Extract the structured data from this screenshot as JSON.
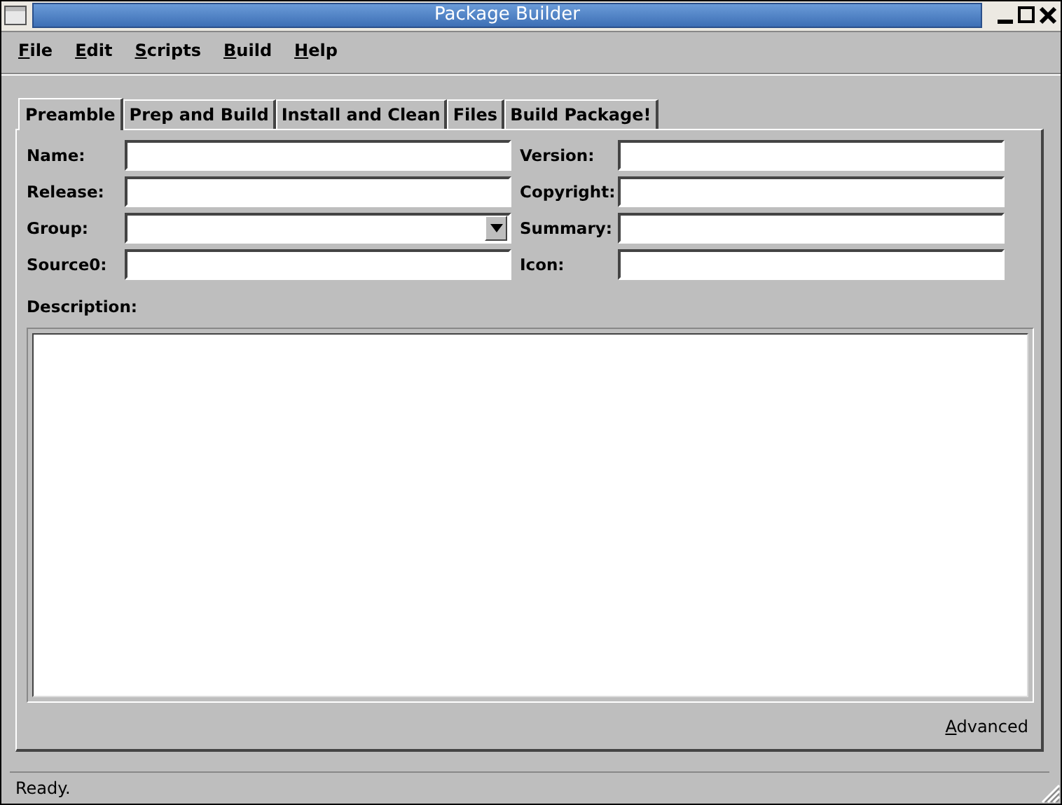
{
  "window": {
    "title": "Package Builder"
  },
  "menu": [
    "File",
    "Edit",
    "Scripts",
    "Build",
    "Help"
  ],
  "tabs": [
    {
      "label": "Preamble",
      "selected": true
    },
    {
      "label": "Prep and Build",
      "selected": false
    },
    {
      "label": "Install and Clean",
      "selected": false
    },
    {
      "label": "Files",
      "selected": false
    },
    {
      "label": "Build Package!",
      "selected": false
    }
  ],
  "fields": [
    {
      "label": "Name:",
      "kind": "text"
    },
    {
      "label": "Version:",
      "kind": "text"
    },
    {
      "label": "Release:",
      "kind": "text"
    },
    {
      "label": "Copyright:",
      "kind": "text"
    },
    {
      "label": "Group:",
      "kind": "combo"
    },
    {
      "label": "Summary:",
      "kind": "text"
    },
    {
      "label": "Source0:",
      "kind": "text"
    },
    {
      "label": "Icon:",
      "kind": "text"
    }
  ],
  "description": {
    "label": "Description:"
  },
  "advanced_button": "Advanced",
  "status_bar": "Ready."
}
